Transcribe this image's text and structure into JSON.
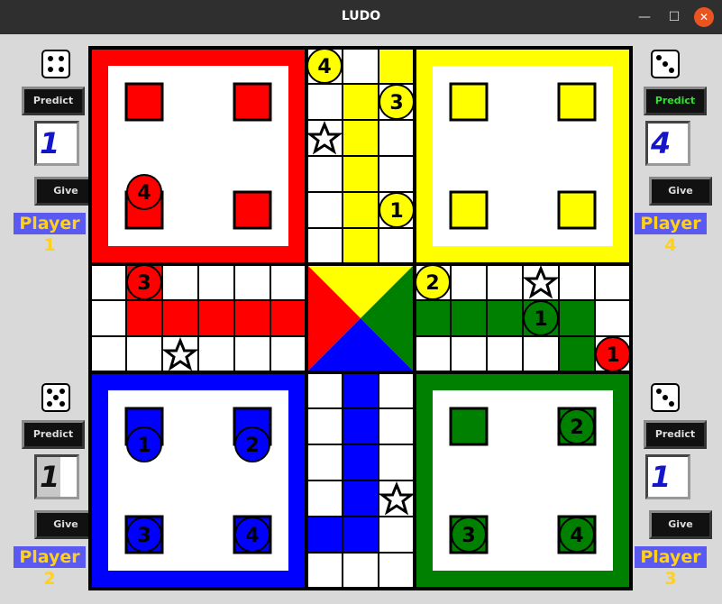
{
  "window": {
    "title": "LUDO",
    "min_icon": "minimize-icon",
    "max_icon": "maximize-icon",
    "close_icon": "close-icon"
  },
  "colors": {
    "red": "#ff0000",
    "yellow": "#ffff00",
    "green": "#008000",
    "blue": "#0000ff",
    "white": "#ffffff",
    "black": "#000000"
  },
  "players": {
    "p1": {
      "predict": "Predict",
      "value": "1",
      "give": "Give",
      "label": "Player 1",
      "die_face": 4
    },
    "p2": {
      "predict": "Predict",
      "value": "1",
      "give": "Give",
      "label": "Player 2",
      "die_face": 5
    },
    "p3": {
      "predict": "Predict",
      "value": "1",
      "give": "Give",
      "label": "Player 3",
      "die_face": 3
    },
    "p4": {
      "predict": "Predict",
      "value": "4",
      "give": "Give",
      "label": "Player 4",
      "die_face": 3
    }
  },
  "tokens": {
    "red": [
      "4",
      "3"
    ],
    "yellow": [
      "4",
      "3",
      "1",
      "2"
    ],
    "green": [
      "1",
      "2",
      "3",
      "4"
    ],
    "red_green_cell": "1",
    "blue": [
      "1",
      "2",
      "3",
      "4"
    ]
  },
  "board": {
    "safe_icon": "star-icon"
  }
}
